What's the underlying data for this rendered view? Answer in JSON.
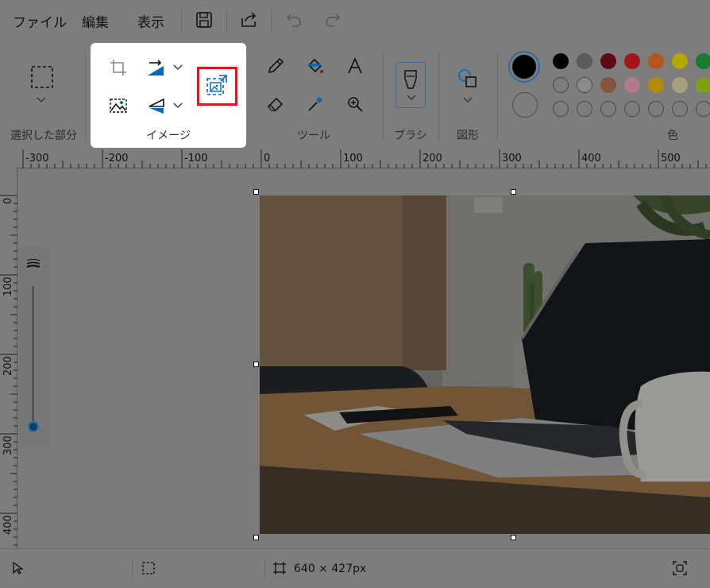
{
  "menu": {
    "file": "ファイル",
    "edit": "編集",
    "view": "表示"
  },
  "ribbon": {
    "selection_label": "選択した部分",
    "image_label": "イメージ",
    "tools_label": "ツール",
    "brush_label": "ブラシ",
    "shapes_label": "図形",
    "colors_label": "色"
  },
  "colors": {
    "primary": "#000000",
    "secondary": "#ffffff",
    "accent": "#0067c0",
    "highlight": "#e0191d",
    "palette_row1": [
      "#000000",
      "#7f7f7f",
      "#880015",
      "#ed1c24",
      "#ff7f27",
      "#fff200",
      "#22b14c"
    ],
    "palette_row2": [
      "#ffffff",
      "#c3c3c3",
      "#b97a57",
      "#ffaec9",
      "#ffc90e",
      "#efe4b0",
      "#b5e61d"
    ]
  },
  "ruler": {
    "top_labels": [
      "-300",
      "-200",
      "-100",
      "0",
      "100",
      "200",
      "300",
      "400",
      "500"
    ],
    "left_labels": [
      "0",
      "100",
      "200",
      "300",
      "400"
    ]
  },
  "canvas": {
    "image_description": "laptop-on-desk-photo"
  },
  "status": {
    "canvas_size": "640 × 427px"
  }
}
